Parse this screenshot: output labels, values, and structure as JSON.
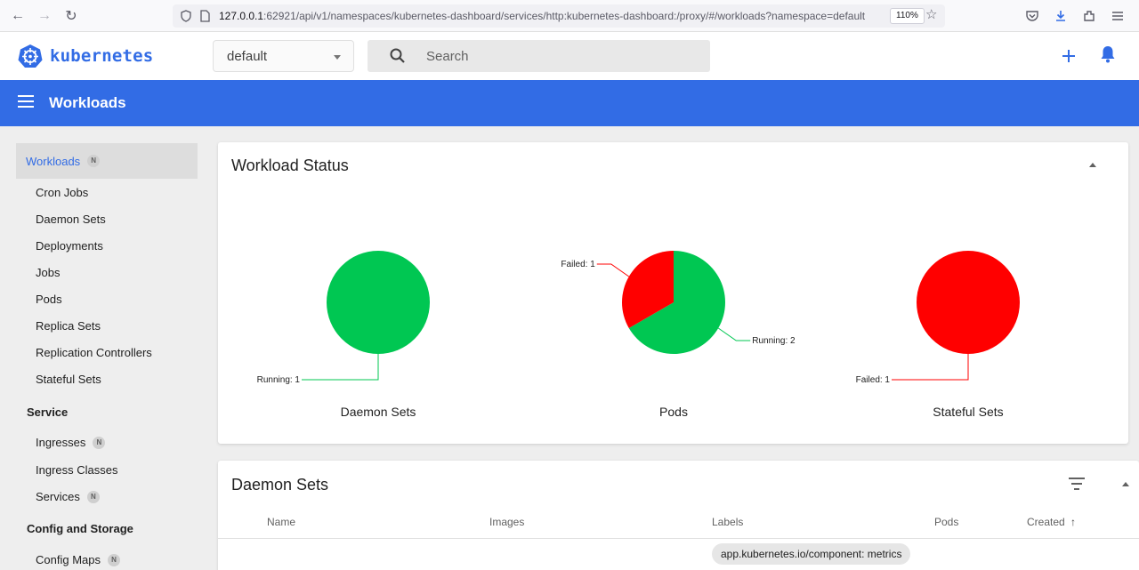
{
  "browser": {
    "url_host": "127.0.0.1",
    "url_rest": ":62921/api/v1/namespaces/kubernetes-dashboard/services/http:kubernetes-dashboard:/proxy/#/workloads?namespace=default",
    "zoom": "110%"
  },
  "header": {
    "logo_text": "kubernetes",
    "namespace": "default",
    "search_placeholder": "Search"
  },
  "toolbar": {
    "title": "Workloads"
  },
  "sidebar": {
    "top": {
      "label": "Workloads",
      "badge": "N"
    },
    "workload_items": [
      "Cron Jobs",
      "Daemon Sets",
      "Deployments",
      "Jobs",
      "Pods",
      "Replica Sets",
      "Replication Controllers",
      "Stateful Sets"
    ],
    "service_section": "Service",
    "service_items": [
      {
        "label": "Ingresses",
        "badge": "N"
      },
      {
        "label": "Ingress Classes",
        "badge": ""
      },
      {
        "label": "Services",
        "badge": "N"
      }
    ],
    "config_section": "Config and Storage",
    "config_items": [
      {
        "label": "Config Maps",
        "badge": "N"
      }
    ]
  },
  "workload_status": {
    "title": "Workload Status",
    "charts": [
      {
        "title": "Daemon Sets",
        "slices": [
          {
            "label": "Running",
            "value": 1,
            "color": "#00c752"
          }
        ]
      },
      {
        "title": "Pods",
        "slices": [
          {
            "label": "Running",
            "value": 2,
            "color": "#00c752"
          },
          {
            "label": "Failed",
            "value": 1,
            "color": "#ff0000"
          }
        ]
      },
      {
        "title": "Stateful Sets",
        "slices": [
          {
            "label": "Failed",
            "value": 1,
            "color": "#ff0000"
          }
        ]
      }
    ]
  },
  "daemon_sets": {
    "title": "Daemon Sets",
    "columns": [
      "Name",
      "Images",
      "Labels",
      "Pods",
      "Created"
    ],
    "sort_indicator": "↑",
    "first_row_label": "app.kubernetes.io/component: metrics"
  }
}
